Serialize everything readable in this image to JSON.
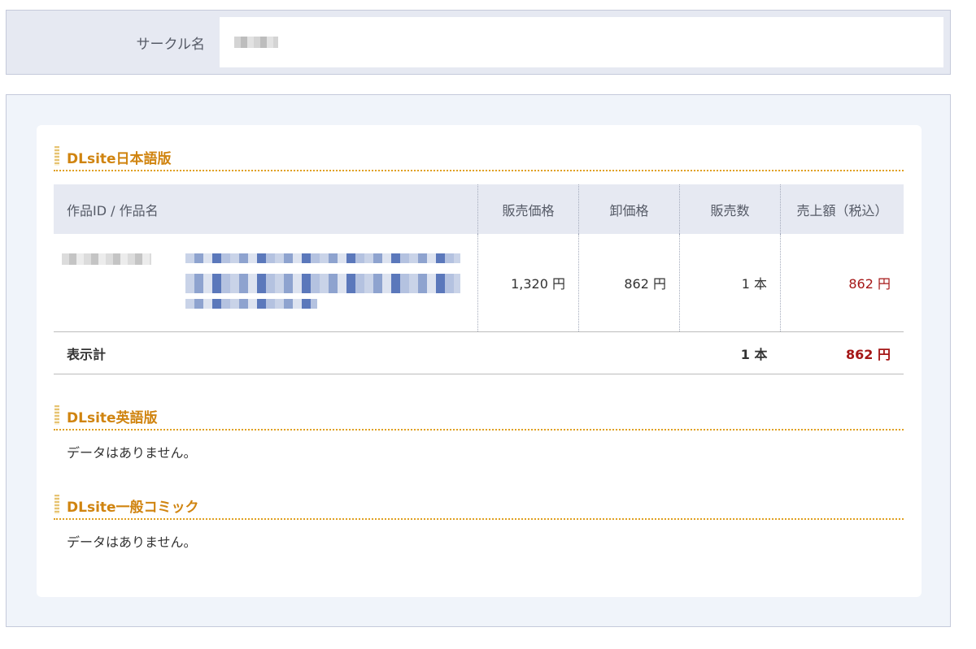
{
  "circle": {
    "label": "サークル名"
  },
  "sections": [
    {
      "title": "DLsite日本語版",
      "table": {
        "headers": [
          "作品ID / 作品名",
          "販売価格",
          "卸価格",
          "販売数",
          "売上額（税込）"
        ],
        "rows": [
          {
            "price": "1,320 円",
            "wholesale": "862 円",
            "count": "1 本",
            "sales": "862 円"
          }
        ],
        "total": {
          "label": "表示計",
          "count": "1 本",
          "sales": "862 円"
        }
      }
    },
    {
      "title": "DLsite英語版",
      "empty_message": "データはありません。"
    },
    {
      "title": "DLsite一般コミック",
      "empty_message": "データはありません。"
    }
  ],
  "colors": {
    "accent": "#d08410",
    "sales_red": "#a51717",
    "header_bg": "#e6e9f2"
  }
}
